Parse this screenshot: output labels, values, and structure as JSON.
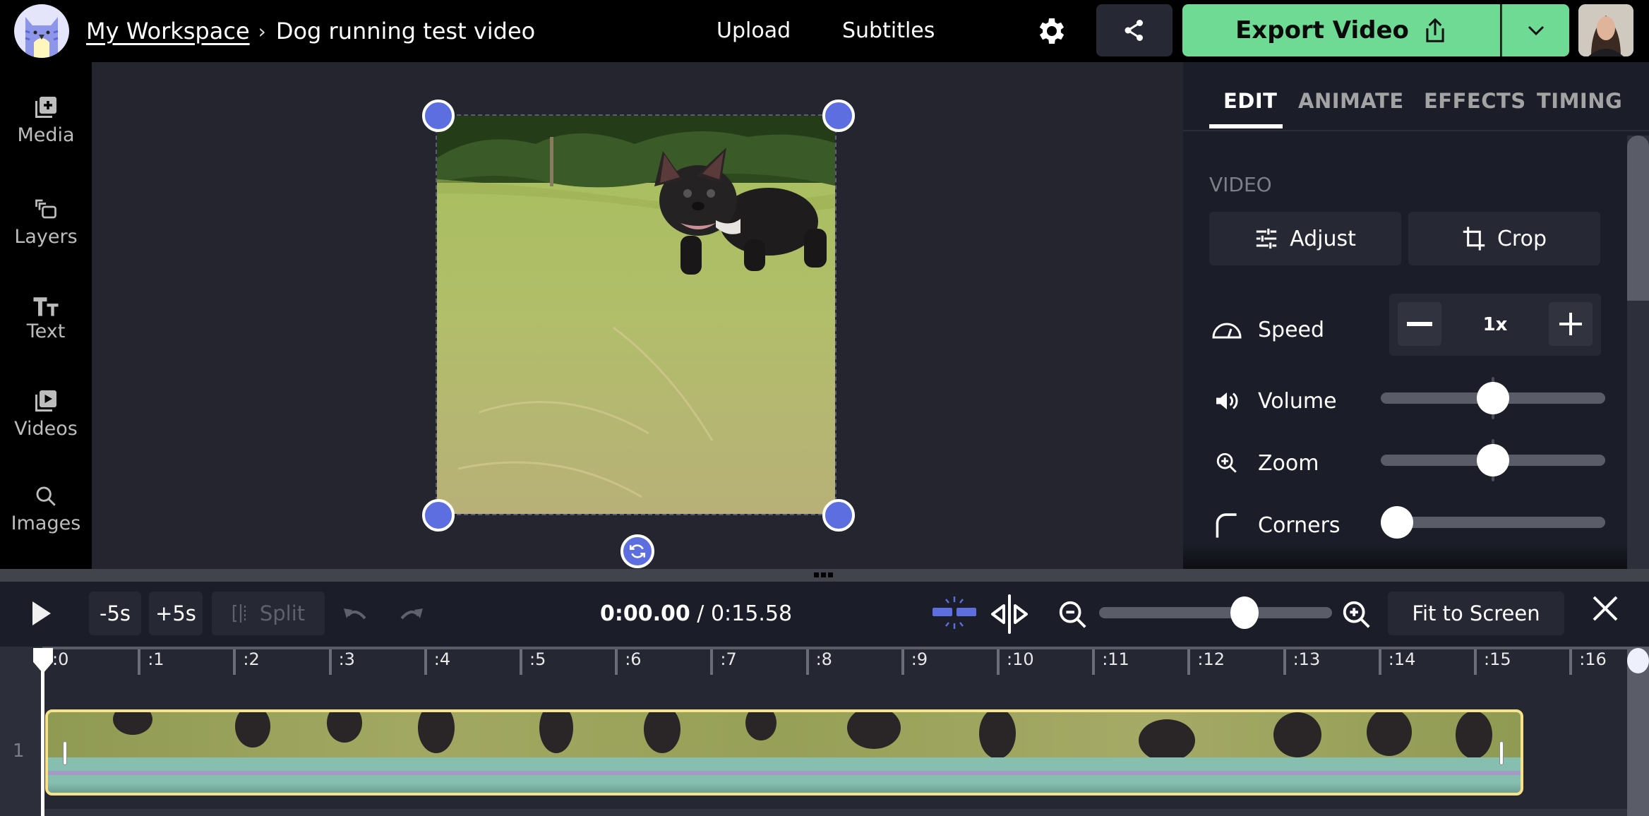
{
  "header": {
    "workspace_link": "My Workspace",
    "breadcrumb_separator": "›",
    "project_title": "Dog running test video",
    "nav": {
      "upload": "Upload",
      "subtitles": "Subtitles"
    },
    "export_label": "Export Video",
    "icons": {
      "settings": "gear-icon",
      "share": "share-icon",
      "export": "upload-icon",
      "dropdown": "chevron-down-icon"
    }
  },
  "sidebar": {
    "items": [
      {
        "label": "Media",
        "icon": "media-add-icon"
      },
      {
        "label": "Layers",
        "icon": "layers-icon"
      },
      {
        "label": "Text",
        "icon": "text-icon"
      },
      {
        "label": "Videos",
        "icon": "video-library-icon"
      },
      {
        "label": "Images",
        "icon": "search-icon"
      }
    ]
  },
  "panel": {
    "tabs": [
      {
        "label": "EDIT",
        "active": true
      },
      {
        "label": "ANIMATE",
        "active": false
      },
      {
        "label": "EFFECTS",
        "active": false
      },
      {
        "label": "TIMING",
        "active": false
      }
    ],
    "section_label": "VIDEO",
    "adjust_label": "Adjust",
    "crop_label": "Crop",
    "speed": {
      "label": "Speed",
      "value": "1x"
    },
    "volume": {
      "label": "Volume",
      "value_fraction": 0.5
    },
    "zoom": {
      "label": "Zoom",
      "value_fraction": 0.5
    },
    "corners": {
      "label": "Corners",
      "value_fraction": 0.0
    }
  },
  "toolbar": {
    "back_label": "-5s",
    "forward_label": "+5s",
    "split_label": "Split",
    "current_time": "0:00.00",
    "time_separator": " / ",
    "total_time": "0:15.58",
    "timeline_zoom_fraction": 0.64,
    "fit_label": "Fit to Screen"
  },
  "timeline": {
    "ruler_labels": [
      ":0",
      ":1",
      ":2",
      ":3",
      ":4",
      ":5",
      ":6",
      ":7",
      ":8",
      ":9",
      ":10",
      ":11",
      ":12",
      ":13",
      ":14",
      ":15",
      ":16"
    ],
    "track_number": "1",
    "clip_duration_seconds": 15.58,
    "playhead_seconds": 0
  },
  "colors": {
    "accent": "#5c6ee0",
    "export": "#6fda94",
    "clip_border": "#f7e28a",
    "clip_audio": "#86bfb0"
  }
}
